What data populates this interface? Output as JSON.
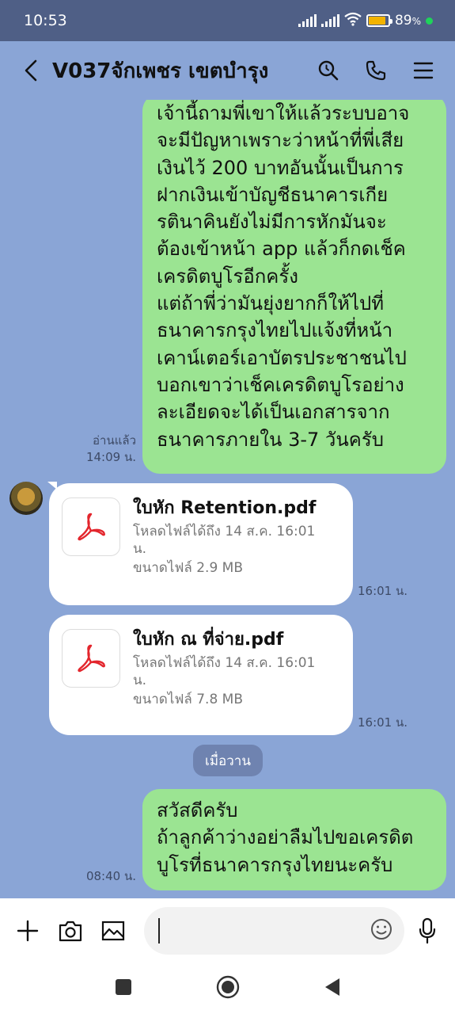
{
  "status_bar": {
    "time": "10:53",
    "battery_text": "89",
    "battery_unit": "%",
    "battery_level": 0.89,
    "accent": "#1fd35a"
  },
  "header": {
    "title": "V037จักเพชร เขตบำรุง",
    "icons": [
      "back-arrow-icon",
      "search-icon",
      "phone-icon",
      "menu-icon"
    ]
  },
  "messages": {
    "long_text_lines": [
      "เจ้านี้ถามพี่เขาให้แล้วระบบอาจ",
      "จะมีปัญหาเพราะว่าหน้าที่พี่เสีย",
      "เงินไว้ 200 บาทอันนั้นเป็นการ",
      "ฝากเงินเข้าบัญชีธนาคารเกีย",
      "รตินาคินยังไม่มีการหักมันจะ",
      "ต้องเข้าหน้า app แล้วก็กดเช็ค",
      "เครดิตบูโรอีกครั้ง",
      "แต่ถ้าพี่ว่ามันยุ่งยากก็ให้ไปที่",
      "ธนาคารกรุงไทยไปแจ้งที่หน้า",
      "เคาน์เตอร์เอาบัตรประชาชนไป",
      "บอกเขาว่าเช็คเครดิตบูโรอย่าง",
      "ละเอียดจะได้เป็นเอกสารจาก",
      "ธนาคารภายใน 3-7 วันครับ"
    ],
    "long_text_read": "อ่านแล้ว",
    "long_text_time": "14:09 น.",
    "file1": {
      "name": "ใบหัก Retention.pdf",
      "download_line1": "โหลดไฟล์ได้ถึง 14 ส.ค. 16:01",
      "download_line2": "น.",
      "size": "ขนาดไฟล์ 2.9 MB",
      "time": "16:01 น."
    },
    "file2": {
      "name": "ใบหัก ณ ที่จ่าย.pdf",
      "download_line1": "โหลดไฟล์ได้ถึง 14 ส.ค. 16:01",
      "download_line2": "น.",
      "size": "ขนาดไฟล์ 7.8 MB",
      "time": "16:01 น."
    },
    "date_separator": "เมื่อวาน",
    "last_text_lines": [
      "สวัสดีครับ",
      "ถ้าลูกค้าว่างอย่าลืมไปขอเครดิต",
      "บูโรที่ธนาคารกรุงไทยนะครับ"
    ],
    "last_text_time": "08:40 น.",
    "colors": {
      "chat_bg": "#8aa5d6",
      "out_bubble": "#9be492",
      "in_bubble": "#ffffff",
      "pdf_red": "#e3262d"
    }
  },
  "input_bar": {
    "placeholder": "",
    "icons": [
      "plus-icon",
      "camera-icon",
      "image-icon",
      "emoji-icon",
      "microphone-icon"
    ]
  },
  "nav_bar": {
    "icons": [
      "recents-square-icon",
      "home-circle-icon",
      "back-triangle-icon"
    ]
  }
}
